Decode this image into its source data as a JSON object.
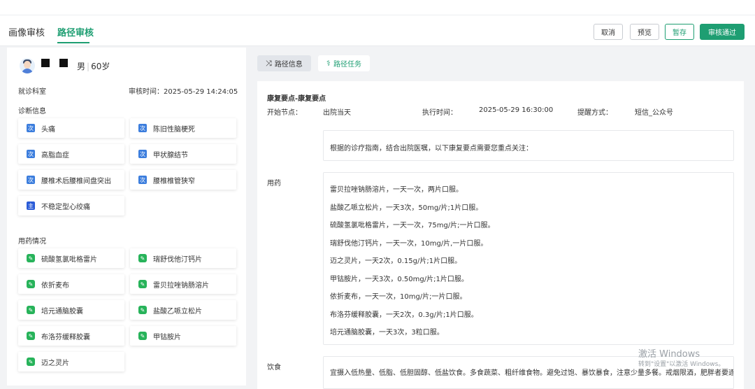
{
  "header": {
    "tabs": [
      {
        "label": "画像审核",
        "active": false
      },
      {
        "label": "路径审核",
        "active": true
      }
    ],
    "buttons": {
      "cancel": "取消",
      "preview": "预览",
      "save_draft": "暂存",
      "approve": "审核通过"
    }
  },
  "patient": {
    "gender": "男",
    "age": "60岁",
    "dept_label": "就诊科室",
    "review_time": "审核时间：2025-05-29 14:24:05"
  },
  "diagnosis": {
    "title": "诊断信息",
    "badge_secondary": "次",
    "badge_main": "主",
    "items": [
      "头痛",
      "陈旧性脑梗死",
      "高脂血症",
      "甲状腺结节",
      "腰椎术后腰椎间盘突出",
      "腰椎椎管狭窄",
      "不稳定型心绞痛"
    ]
  },
  "medication": {
    "title": "用药情况",
    "items": [
      "硫酸氢氯吡格雷片",
      "瑞舒伐他汀钙片",
      "依折麦布",
      "雷贝拉唑钠肠溶片",
      "培元通脑胶囊",
      "盐酸乙哌立松片",
      "布洛芬缓释胶囊",
      "甲钴胺片",
      "迈之灵片"
    ]
  },
  "right": {
    "tabs": {
      "info": "路径信息",
      "task": "路径任务"
    },
    "section_title": "康复要点-康复要点",
    "start_node_label": "开始节点：",
    "start_node_value": "出院当天",
    "exec_time_label": "执行时间：",
    "exec_time_value": "2025-05-29 16:30:00",
    "remind_label": "提醒方式：",
    "remind_value": "短信_公众号",
    "intro": "根据的诊疗指南，结合出院医嘱，以下康复要点需要您重点关注：",
    "med_label": "用药",
    "med_lines": [
      "雷贝拉唑钠肠溶片，一天一次，两片口服。",
      "盐酸乙哌立松片，一天3次，50mg/片;1片口服。",
      "硫酸氢氯吡格雷片，一天一次，75mg/片;一片口服。",
      "瑞舒伐他汀钙片，一天一次，10mg/片,一片口服。",
      "迈之灵片，一天2次，0.15g/片;1片口服。",
      "甲钴胺片，一天3次，0.50mg/片;1片口服。",
      "依折麦布，一天一次，10mg/片;一片口服。",
      "布洛芬缓释胶囊，一天2次，0.3g/片;1片口服。",
      "培元通脑胶囊，一天3次，3粒口服。"
    ],
    "diet_label": "饮食",
    "diet_text": "宜摄入低热量、低脂、低胆固醇、低盐饮食。多食蔬菜、粗纤维食物。避免过饱、暴饮暴食，注意少量多餐。戒烟限酒，肥胖者要逐"
  },
  "os_overlay": {
    "line1": "激活 Windows",
    "line2": "转到\"设置\"以激活 Windows。"
  }
}
